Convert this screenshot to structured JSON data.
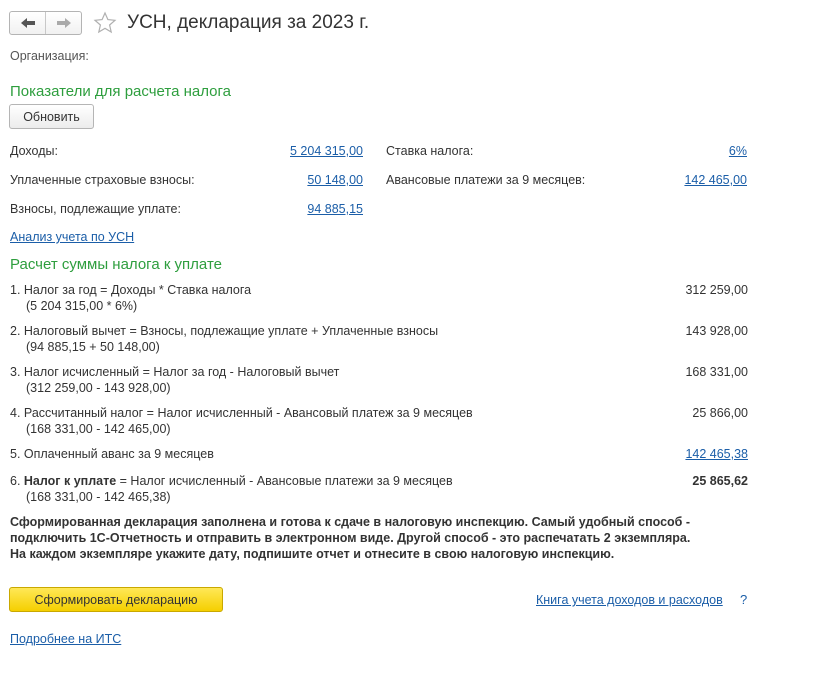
{
  "header": {
    "title": "УСН, декларация за 2023 г."
  },
  "org": {
    "label": "Организация:"
  },
  "indicators": {
    "title": "Показатели для расчета налога",
    "refresh_label": "Обновить",
    "income_label": "Доходы:",
    "income_value": "5 204 315,00",
    "paid_contrib_label": "Уплаченные страховые взносы:",
    "paid_contrib_value": "50 148,00",
    "due_contrib_label": "Взносы, подлежащие уплате:",
    "due_contrib_value": "94 885,15",
    "rate_label": "Ставка налога:",
    "rate_value": "6%",
    "advance_label": "Авансовые платежи за 9 месяцев:",
    "advance_value": "142 465,00"
  },
  "analysis_link": "Анализ учета по УСН",
  "calc": {
    "title": "Расчет суммы налога к уплате",
    "rows": [
      {
        "line1": "1. Налог за год = Доходы * Ставка налога",
        "line2": "(5 204 315,00 * 6%)",
        "value": "312 259,00"
      },
      {
        "line1": "2. Налоговый вычет = Взносы, подлежащие уплате + Уплаченные взносы",
        "line2": "(94 885,15 + 50 148,00)",
        "value": "143 928,00"
      },
      {
        "line1": "3. Налог исчисленный = Налог за год - Налоговый вычет",
        "line2": "(312 259,00 - 143 928,00)",
        "value": "168 331,00"
      },
      {
        "line1": "4. Рассчитанный налог = Налог исчисленный - Авансовый платеж за 9 месяцев",
        "line2": "(168 331,00 - 142 465,00)",
        "value": "25 866,00"
      },
      {
        "line1": "5. Оплаченный аванс за 9 месяцев",
        "line2": "",
        "value": "142 465,38"
      },
      {
        "prefix": "6. ",
        "bold_part": "Налог к уплате",
        "line1_rest": " = Налог исчисленный - Авансовые платежи за 9 месяцев",
        "line2": "(168 331,00 - 142 465,38)",
        "value": "25 865,62"
      }
    ]
  },
  "note": "Сформированная декларация заполнена и готова к сдаче в налоговую инспекцию. Самый удобный способ - подключить 1С-Отчетность и отправить в электронном виде. Другой способ - это распечатать 2 экземпляра. На каждом экземпляре укажите дату, подпишите отчет и отнесите в свою налоговую инспекцию.",
  "actions": {
    "generate_label": "Сформировать декларацию",
    "book_link": "Книга учета доходов и расходов",
    "help": "?"
  },
  "its_link": "Подробнее на ИТС",
  "colors": {
    "section_title": "#2e9e3e",
    "link": "#1b5ea8",
    "primary_button": "#f5cf00"
  }
}
